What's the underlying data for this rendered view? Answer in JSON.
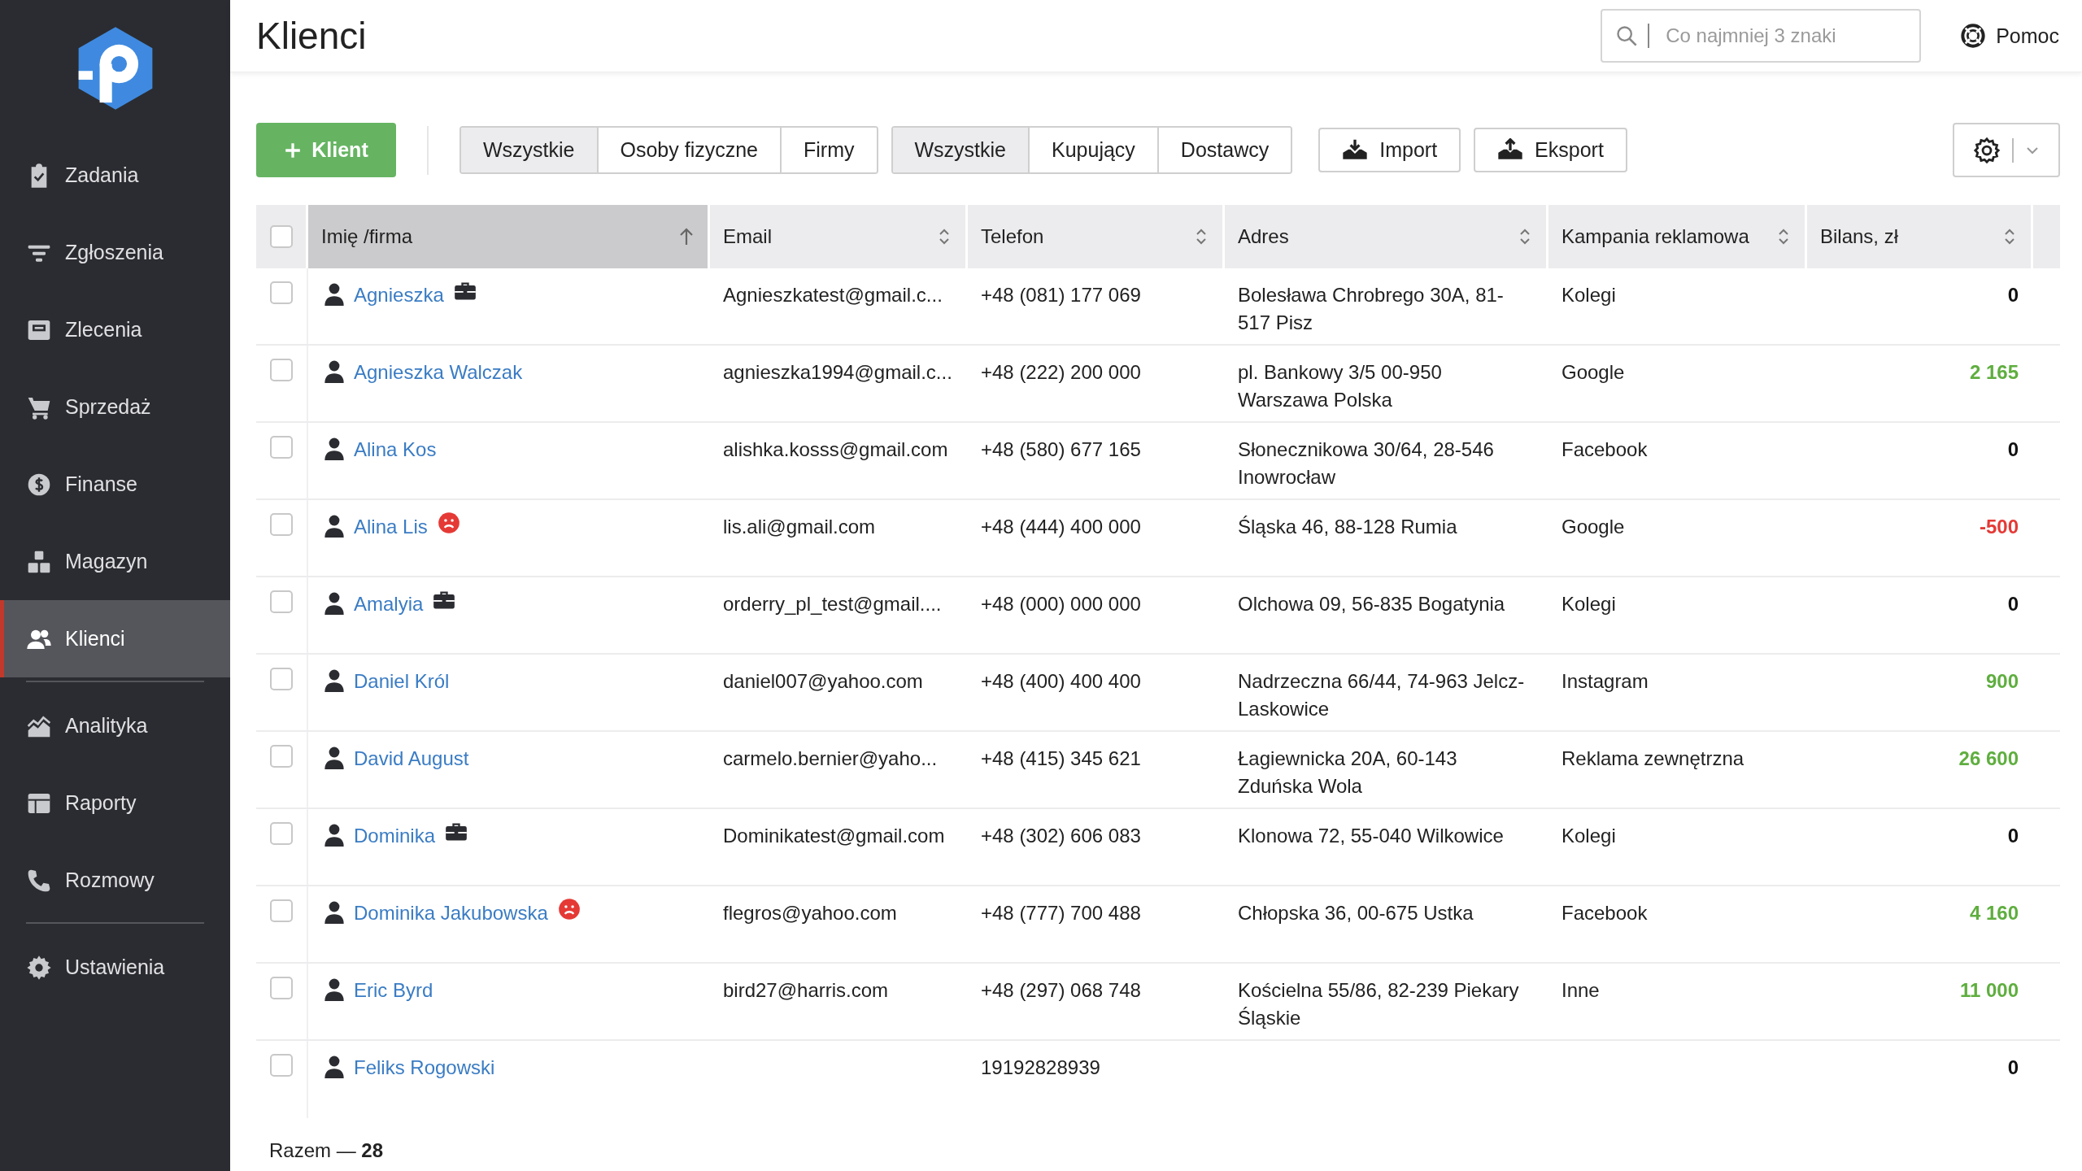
{
  "sidebar": {
    "sections": [
      {
        "items": [
          {
            "label": "Zadania",
            "selected": false
          },
          {
            "label": "Zgłoszenia",
            "selected": false
          },
          {
            "label": "Zlecenia",
            "selected": false
          },
          {
            "label": "Sprzedaż",
            "selected": false
          },
          {
            "label": "Finanse",
            "selected": false
          },
          {
            "label": "Magazyn",
            "selected": false
          },
          {
            "label": "Klienci",
            "selected": true
          }
        ]
      },
      {
        "items": [
          {
            "label": "Analityka",
            "selected": false
          },
          {
            "label": "Raporty",
            "selected": false
          },
          {
            "label": "Rozmowy",
            "selected": false
          }
        ]
      },
      {
        "items": [
          {
            "label": "Ustawienia",
            "selected": false
          }
        ]
      }
    ]
  },
  "header": {
    "title": "Klienci",
    "search": {
      "placeholder": "Co najmniej 3 znaki"
    },
    "help": "Pomoc"
  },
  "toolbar": {
    "add_button": "Klient",
    "filter_groups": [
      [
        {
          "label": "Wszystkie",
          "selected": true
        },
        {
          "label": "Osoby fizyczne",
          "selected": false
        },
        {
          "label": "Firmy",
          "selected": false
        }
      ],
      [
        {
          "label": "Wszystkie",
          "selected": true
        },
        {
          "label": "Kupujący",
          "selected": false
        },
        {
          "label": "Dostawcy",
          "selected": false
        }
      ]
    ],
    "actions": [
      {
        "label": "Import",
        "kind": "import"
      },
      {
        "label": "Eksport",
        "kind": "export"
      }
    ]
  },
  "table": {
    "all_checked": false,
    "columns": [
      {
        "label": "Imię /firma",
        "sorted": true
      },
      {
        "label": "Email",
        "sorted": false
      },
      {
        "label": "Telefon",
        "sorted": false
      },
      {
        "label": "Adres",
        "sorted": false
      },
      {
        "label": "Kampania reklamowa",
        "sorted": false
      },
      {
        "label": "Bilans, zł",
        "sorted": false
      }
    ],
    "rows": [
      {
        "checked": false,
        "name": "Agnieszka",
        "company": true,
        "flagged": false,
        "email": "Agnieszkatest@gmail.c...",
        "phone": "+48 (081) 177 069",
        "address": "Bolesława Chrobrego 30A, 81-517 Pisz",
        "campaign": "Kolegi",
        "balance": "0",
        "color": "#111111"
      },
      {
        "checked": false,
        "name": "Agnieszka Walczak",
        "company": false,
        "flagged": false,
        "email": "agnieszka1994@gmail.c...",
        "phone": "+48 (222) 200 000",
        "address": "pl. Bankowy 3/5 00-950 Warszawa Polska",
        "campaign": "Google",
        "balance": "2 165",
        "color": "#5fae3f"
      },
      {
        "checked": false,
        "name": "Alina Kos",
        "company": false,
        "flagged": false,
        "email": "alishka.kosss@gmail.com",
        "phone": "+48 (580) 677 165",
        "address": "Słonecznikowa 30/64, 28-546 Inowrocław",
        "campaign": "Facebook",
        "balance": "0",
        "color": "#111111"
      },
      {
        "checked": false,
        "name": "Alina Lis",
        "company": false,
        "flagged": true,
        "email": "lis.ali@gmail.com",
        "phone": "+48 (444) 400 000",
        "address": "Śląska 46, 88-128 Rumia",
        "campaign": "Google",
        "balance": "-500",
        "color": "#e53935"
      },
      {
        "checked": false,
        "name": "Amalyia",
        "company": true,
        "flagged": false,
        "email": "orderry_pl_test@gmail....",
        "phone": "+48 (000) 000 000",
        "address": "Olchowa 09, 56-835 Bogatynia",
        "campaign": "Kolegi",
        "balance": "0",
        "color": "#111111"
      },
      {
        "checked": false,
        "name": "Daniel Król",
        "company": false,
        "flagged": false,
        "email": "daniel007@yahoo.com",
        "phone": "+48 (400) 400 400",
        "address": "Nadrzeczna 66/44, 74-963 Jelcz-Laskowice",
        "campaign": "Instagram",
        "balance": "900",
        "color": "#5fae3f"
      },
      {
        "checked": false,
        "name": "David August",
        "company": false,
        "flagged": false,
        "email": "carmelo.bernier@yaho...",
        "phone": "+48 (415) 345 621",
        "address": "Łagiewnicka 20A, 60-143 Zduńska Wola",
        "campaign": "Reklama zewnętrzna",
        "balance": "26 600",
        "color": "#5fae3f"
      },
      {
        "checked": false,
        "name": "Dominika",
        "company": true,
        "flagged": false,
        "email": "Dominikatest@gmail.com",
        "phone": "+48 (302) 606 083",
        "address": "Klonowa 72, 55-040 Wilkowice",
        "campaign": "Kolegi",
        "balance": "0",
        "color": "#111111"
      },
      {
        "checked": false,
        "name": "Dominika Jakubowska",
        "company": false,
        "flagged": true,
        "email": "flegros@yahoo.com",
        "phone": "+48 (777) 700 488",
        "address": "Chłopska 36, 00-675 Ustka",
        "campaign": "Facebook",
        "balance": "4 160",
        "color": "#5fae3f"
      },
      {
        "checked": false,
        "name": "Eric Byrd",
        "company": false,
        "flagged": false,
        "email": "bird27@harris.com",
        "phone": "+48 (297) 068 748",
        "address": "Kościelna 55/86, 82-239 Piekary Śląskie",
        "campaign": "Inne",
        "balance": "11 000",
        "color": "#5fae3f"
      },
      {
        "checked": false,
        "name": "Feliks Rogowski",
        "company": false,
        "flagged": false,
        "phone": "19192828939",
        "balance": "0",
        "color": "#111111"
      }
    ]
  },
  "footer": {
    "total": "Razem — **28**"
  }
}
